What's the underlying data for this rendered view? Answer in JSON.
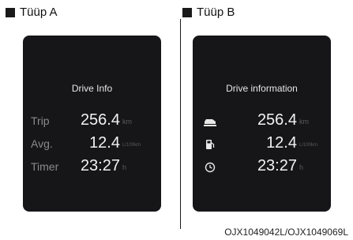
{
  "type_a": {
    "header": "Tüüp A",
    "title": "Drive Info",
    "rows": [
      {
        "label": "Trip",
        "value": "256.4",
        "unit": "km"
      },
      {
        "label": "Avg.",
        "value": "12.4",
        "unit": "L/100km"
      },
      {
        "label": "Timer",
        "value": "23:27",
        "unit": "h"
      }
    ]
  },
  "type_b": {
    "header": "Tüüp B",
    "title": "Drive information",
    "rows": [
      {
        "icon": "car-icon",
        "value": "256.4",
        "unit": "km"
      },
      {
        "icon": "fuel-pump-icon",
        "value": "12.4",
        "unit": "L/100km"
      },
      {
        "icon": "clock-icon",
        "value": "23:27",
        "unit": "h"
      }
    ]
  },
  "caption": "OJX1049042L/OJX1049069L"
}
